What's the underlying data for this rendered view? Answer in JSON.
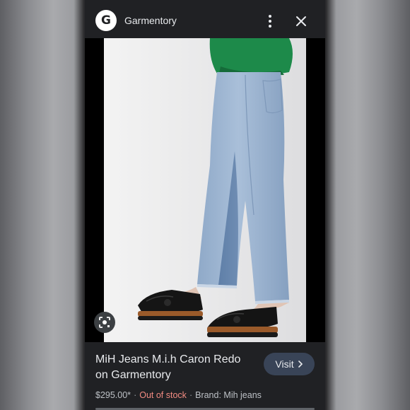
{
  "header": {
    "logo_letter": "G",
    "site_name": "Garmentory",
    "more_icon": "more-vert-icon",
    "close_icon": "close-icon"
  },
  "image": {
    "lens_icon": "image-search-icon"
  },
  "product": {
    "title": "MiH Jeans M.i.h Caron Redo on Garmentory",
    "visit_label": "Visit",
    "price": "$295.00*",
    "stock_status": "Out of stock",
    "brand": "Brand: Mih jeans",
    "separator": "·"
  },
  "colors": {
    "background": "#202124",
    "stock_status": "#f28b82",
    "visit_button": "#394457"
  }
}
